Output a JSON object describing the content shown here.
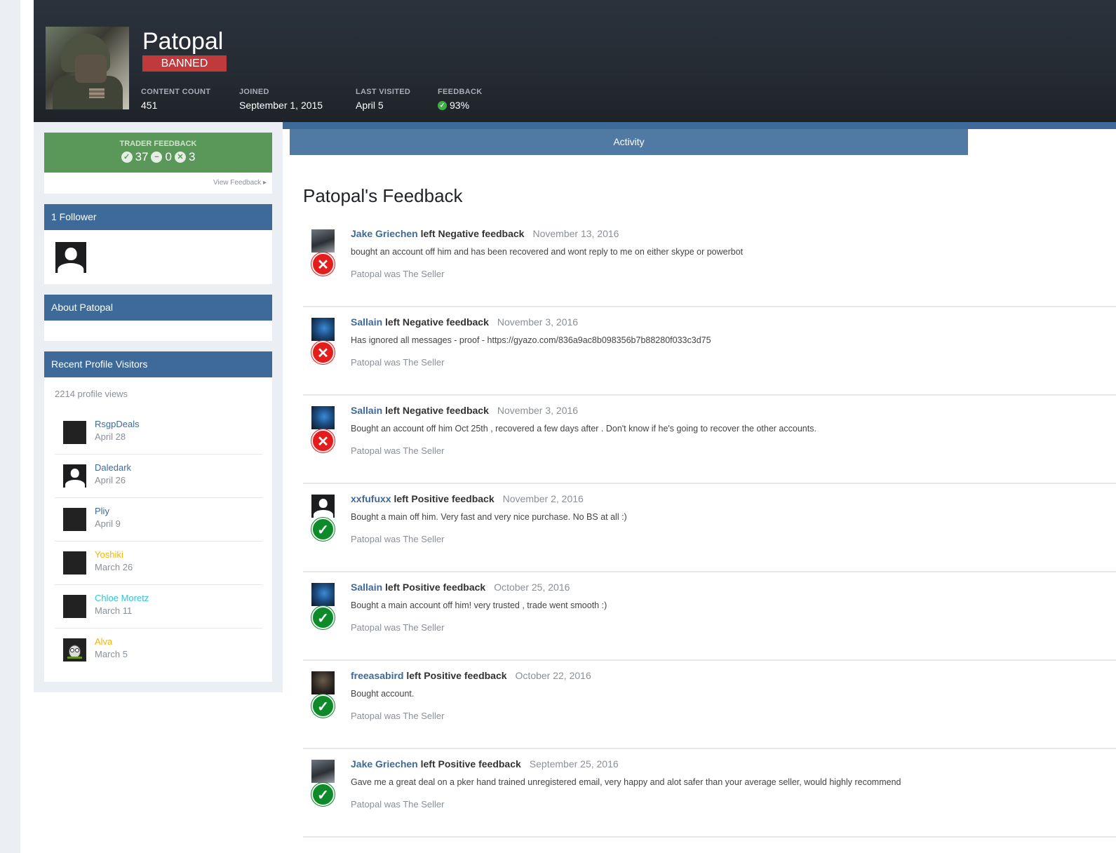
{
  "profile": {
    "username": "Patopal",
    "badge": "BANNED",
    "stats": [
      {
        "label": "CONTENT COUNT",
        "value": "451"
      },
      {
        "label": "JOINED",
        "value": "September 1, 2015"
      },
      {
        "label": "LAST VISITED",
        "value": "April 5"
      },
      {
        "label": "FEEDBACK",
        "value": "93%"
      }
    ]
  },
  "trader_feedback": {
    "label": "TRADER FEEDBACK",
    "positive": "37",
    "neutral": "0",
    "negative": "3",
    "view_link": "View Feedback"
  },
  "sidebar": {
    "followers_title": "1 Follower",
    "about_title": "About Patopal",
    "visitors_title": "Recent Profile Visitors",
    "profile_views": "2214 profile views",
    "visitors": [
      {
        "name": "RsgpDeals",
        "date": "April 28",
        "color": "#3e6a99"
      },
      {
        "name": "Daledark",
        "date": "April 26",
        "color": "#3e6a99"
      },
      {
        "name": "Pliy",
        "date": "April 9",
        "color": "#3e6a99"
      },
      {
        "name": "Yoshiki",
        "date": "March 26",
        "color": "#f2b600"
      },
      {
        "name": "Chloe Moretz",
        "date": "March 11",
        "color": "#2dc7d6"
      },
      {
        "name": "Alva",
        "date": "March 5",
        "color": "#f2b600"
      }
    ]
  },
  "tabs": {
    "activity": "Activity"
  },
  "main": {
    "title": "Patopal's Feedback",
    "feedback": [
      {
        "user": "Jake Griechen",
        "kind": "left Negative feedback",
        "date": "November 13, 2016",
        "text": "bought an account off him and has been recovered and wont reply to me on either skype or powerbot",
        "role": "Patopal was The Seller",
        "type": "negative"
      },
      {
        "user": "Sallain",
        "kind": "left Negative feedback",
        "date": "November 3, 2016",
        "text": "Has ignored all messages - proof - https://gyazo.com/836a9ac8b098356b7b88280f033c3d75",
        "role": "Patopal was The Seller",
        "type": "negative"
      },
      {
        "user": "Sallain",
        "kind": "left Negative feedback",
        "date": "November 3, 2016",
        "text": "Bought an account off him Oct 25th , recovered a few days after . Don't know if he's going to recover the other accounts.",
        "role": "Patopal was The Seller",
        "type": "negative"
      },
      {
        "user": "xxfufuxx",
        "kind": "left Positive feedback",
        "date": "November 2, 2016",
        "text": "Bought a main off him. Very fast and very nice purchase. No BS at all :)",
        "role": "Patopal was The Seller",
        "type": "positive"
      },
      {
        "user": "Sallain",
        "kind": "left Positive feedback",
        "date": "October 25, 2016",
        "text": "Bought a main account off him! very trusted , trade went smooth :)",
        "role": "Patopal was The Seller",
        "type": "positive"
      },
      {
        "user": "freeasabird",
        "kind": "left Positive feedback",
        "date": "October 22, 2016",
        "text": "Bought account.",
        "role": "Patopal was The Seller",
        "type": "positive"
      },
      {
        "user": "Jake Griechen",
        "kind": "left Positive feedback",
        "date": "September 25, 2016",
        "text": "Gave me a great deal on a pker hand trained unregistered email, very happy and alot safer than your average seller, would highly recommend",
        "role": "Patopal was The Seller",
        "type": "positive"
      }
    ]
  },
  "colors": {
    "header_bg": "#252b33",
    "panel_header": "#3e6a99",
    "trader_green": "#5a985a",
    "banned_red": "#c0393b",
    "negative_red": "#e41c1c",
    "positive_green": "#0f8a2b"
  },
  "icons": {
    "positive": "check-circle-icon",
    "neutral": "minus-circle-icon",
    "negative": "x-circle-icon",
    "view_arrow": "caret-right-icon"
  }
}
